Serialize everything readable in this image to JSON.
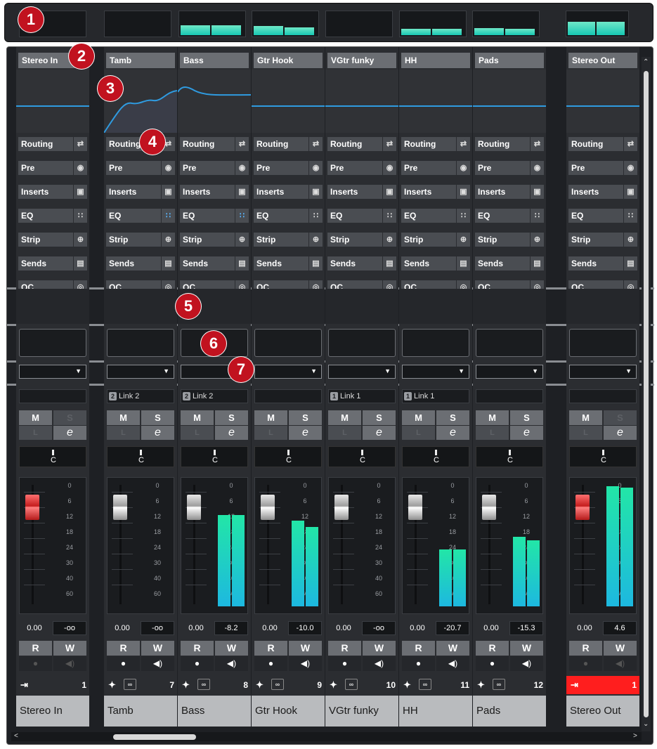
{
  "colors": {
    "accent_teal": "#22e6a7",
    "record_red": "#ff1e1e",
    "callout_red": "#c1121f"
  },
  "callouts": [
    "1",
    "2",
    "3",
    "4",
    "5",
    "6",
    "7"
  ],
  "sections": [
    {
      "label": "Routing",
      "icon": "routing-icon"
    },
    {
      "label": "Pre",
      "icon": "pre-icon"
    },
    {
      "label": "Inserts",
      "icon": "inserts-icon"
    },
    {
      "label": "EQ",
      "icon": "eq-icon"
    },
    {
      "label": "Strip",
      "icon": "strip-icon"
    },
    {
      "label": "Sends",
      "icon": "sends-icon"
    },
    {
      "label": "QC",
      "icon": "quick-controls-icon"
    }
  ],
  "meter_scale": [
    "0",
    "6",
    "12",
    "18",
    "24",
    "30",
    "40",
    "60"
  ],
  "buttons": {
    "mute": "M",
    "solo": "S",
    "listen": "L",
    "edit": "e",
    "read": "R",
    "write": "W"
  },
  "pan_label": "C",
  "channels": [
    {
      "name": "Stereo In",
      "header": "Stereo In",
      "link_num": "",
      "link_label": "",
      "fader": "0.00",
      "peak": "-oo",
      "number": "1",
      "type": "input",
      "meter": [
        0,
        0
      ],
      "overview_meter": [
        0,
        0
      ]
    },
    {
      "name": "Tamb",
      "header": "Tamb",
      "link_num": "2",
      "link_label": "Link 2",
      "fader": "0.00",
      "peak": "-oo",
      "number": "7",
      "type": "audio",
      "meter": [
        0,
        0
      ],
      "overview_meter": [
        0,
        0
      ]
    },
    {
      "name": "Bass",
      "header": "Bass",
      "link_num": "2",
      "link_label": "Link 2",
      "fader": "0.00",
      "peak": "-8.2",
      "number": "8",
      "type": "audio",
      "meter": [
        0.72,
        0.72
      ],
      "overview_meter": [
        0.68,
        0.68
      ]
    },
    {
      "name": "Gtr Hook",
      "header": "Gtr Hook",
      "link_num": "",
      "link_label": "",
      "fader": "0.00",
      "peak": "-10.0",
      "number": "9",
      "type": "audio",
      "meter": [
        0.68,
        0.63
      ],
      "overview_meter": [
        0.62,
        0.56
      ]
    },
    {
      "name": "VGtr funky",
      "header": "VGtr funky",
      "link_num": "1",
      "link_label": "Link 1",
      "fader": "0.00",
      "peak": "-oo",
      "number": "10",
      "type": "audio",
      "meter": [
        0,
        0
      ],
      "overview_meter": [
        0,
        0
      ]
    },
    {
      "name": "HH",
      "header": "HH",
      "link_num": "1",
      "link_label": "Link 1",
      "fader": "0.00",
      "peak": "-20.7",
      "number": "11",
      "type": "audio",
      "meter": [
        0.45,
        0.45
      ],
      "overview_meter": [
        0.42,
        0.42
      ]
    },
    {
      "name": "Pads",
      "header": "Pads",
      "link_num": "",
      "link_label": "",
      "fader": "0.00",
      "peak": "-15.3",
      "number": "12",
      "type": "audio",
      "meter": [
        0.55,
        0.52
      ],
      "overview_meter": [
        0.5,
        0.45
      ]
    },
    {
      "name": "Stereo Out",
      "header": "Stereo Out",
      "link_num": "",
      "link_label": "",
      "fader": "0.00",
      "peak": "4.6",
      "number": "1",
      "type": "output",
      "meter": [
        0.95,
        0.94
      ],
      "overview_meter": [
        0.95,
        0.95
      ]
    }
  ]
}
